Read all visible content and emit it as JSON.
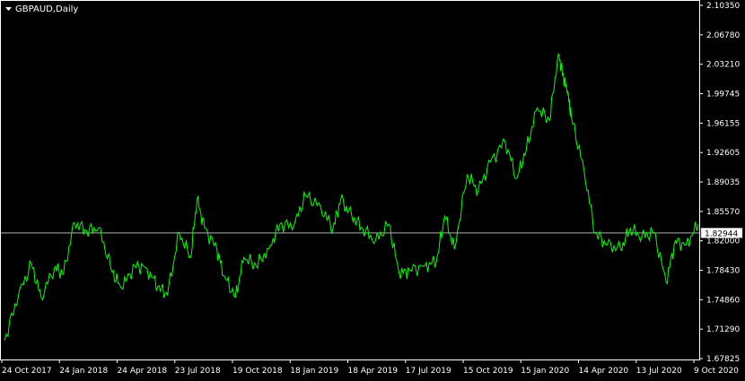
{
  "header": {
    "title": "GBPAUD,Daily",
    "menu_icon": "triangle-down-icon"
  },
  "colors": {
    "background": "#000000",
    "series": "#00ff00",
    "axis": "#ffffff",
    "price_line": "#c0c0c0"
  },
  "current_price": 1.82944,
  "current_price_label": "1.82944",
  "chart_data": {
    "type": "line",
    "symbol": "GBPAUD",
    "timeframe": "Daily",
    "ylim": [
      1.6782,
      2.1035
    ],
    "ytick_labels": [
      "2.10350",
      "2.06780",
      "2.03210",
      "1.99745",
      "1.96155",
      "1.92605",
      "1.89035",
      "1.85570",
      "1.82000",
      "1.78430",
      "1.74860",
      "1.71290",
      "1.67825"
    ],
    "xtick_labels": [
      "24 Oct 2017",
      "24 Jan 2018",
      "24 Apr 2018",
      "23 Jul 2018",
      "19 Oct 2018",
      "18 Jan 2019",
      "18 Apr 2019",
      "17 Jul 2019",
      "15 Oct 2019",
      "15 Jan 2020",
      "14 Apr 2020",
      "13 Jul 2020",
      "9 Oct 2020"
    ],
    "x": [
      "2017-10-24",
      "2017-11-15",
      "2017-12-05",
      "2017-12-20",
      "2018-01-10",
      "2018-01-24",
      "2018-02-10",
      "2018-03-01",
      "2018-03-20",
      "2018-04-10",
      "2018-04-24",
      "2018-05-15",
      "2018-06-01",
      "2018-06-20",
      "2018-07-05",
      "2018-07-23",
      "2018-08-10",
      "2018-08-20",
      "2018-09-01",
      "2018-09-20",
      "2018-10-01",
      "2018-10-19",
      "2018-11-01",
      "2018-11-20",
      "2018-12-10",
      "2018-12-27",
      "2019-01-18",
      "2019-02-05",
      "2019-03-01",
      "2019-03-20",
      "2019-04-01",
      "2019-04-18",
      "2019-05-05",
      "2019-05-25",
      "2019-06-15",
      "2019-07-01",
      "2019-07-17",
      "2019-08-10",
      "2019-08-28",
      "2019-09-10",
      "2019-09-25",
      "2019-10-15",
      "2019-11-01",
      "2019-11-20",
      "2019-12-13",
      "2019-12-31",
      "2020-01-15",
      "2020-02-01",
      "2020-02-20",
      "2020-03-05",
      "2020-03-12",
      "2020-03-19",
      "2020-03-25",
      "2020-04-14",
      "2020-05-01",
      "2020-05-20",
      "2020-06-10",
      "2020-06-25",
      "2020-07-13",
      "2020-08-01",
      "2020-08-20",
      "2020-09-03",
      "2020-09-20",
      "2020-10-09"
    ],
    "y": [
      1.7,
      1.755,
      1.792,
      1.752,
      1.788,
      1.78,
      1.842,
      1.832,
      1.836,
      1.782,
      1.763,
      1.79,
      1.788,
      1.765,
      1.755,
      1.83,
      1.8,
      1.87,
      1.835,
      1.81,
      1.778,
      1.752,
      1.8,
      1.79,
      1.81,
      1.84,
      1.838,
      1.875,
      1.86,
      1.835,
      1.87,
      1.85,
      1.835,
      1.82,
      1.84,
      1.78,
      1.785,
      1.79,
      1.795,
      1.85,
      1.81,
      1.9,
      1.88,
      1.915,
      1.94,
      1.895,
      1.93,
      1.98,
      1.965,
      2.045,
      2.02,
      2.0,
      1.97,
      1.905,
      1.83,
      1.815,
      1.81,
      1.835,
      1.825,
      1.83,
      1.77,
      1.82,
      1.815,
      1.84
    ]
  }
}
